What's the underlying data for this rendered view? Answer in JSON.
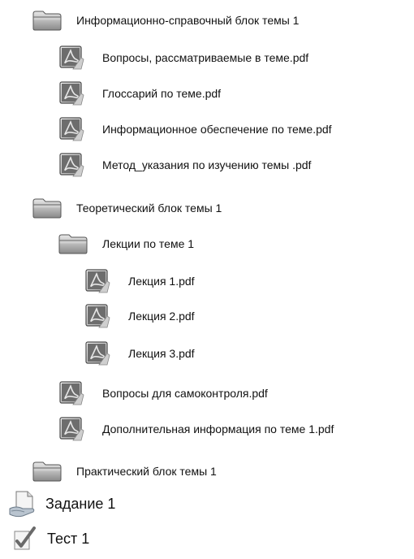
{
  "tree": {
    "items": [
      {
        "type": "folder",
        "label": "Информационно-справочный блок темы 1"
      },
      {
        "type": "pdf",
        "label": "Вопросы, рассматриваемые в теме.pdf"
      },
      {
        "type": "pdf",
        "label": "Глоссарий по теме.pdf"
      },
      {
        "type": "pdf",
        "label": "Информационное обеспечение по теме.pdf"
      },
      {
        "type": "pdf",
        "label": "Метод_указания по изучению темы .pdf"
      },
      {
        "type": "folder",
        "label": "Теоретический блок темы 1"
      },
      {
        "type": "folder",
        "label": "Лекции по теме 1"
      },
      {
        "type": "pdf",
        "label": "Лекция 1.pdf"
      },
      {
        "type": "pdf",
        "label": "Лекция 2.pdf"
      },
      {
        "type": "pdf",
        "label": "Лекция 3.pdf"
      },
      {
        "type": "pdf",
        "label": "Вопросы для самоконтроля.pdf"
      },
      {
        "type": "pdf",
        "label": "Дополнительная информация по теме 1.pdf"
      },
      {
        "type": "folder",
        "label": "Практический блок темы 1"
      },
      {
        "type": "assignment",
        "label": "Задание 1"
      },
      {
        "type": "quiz",
        "label": "Тест 1"
      }
    ]
  }
}
